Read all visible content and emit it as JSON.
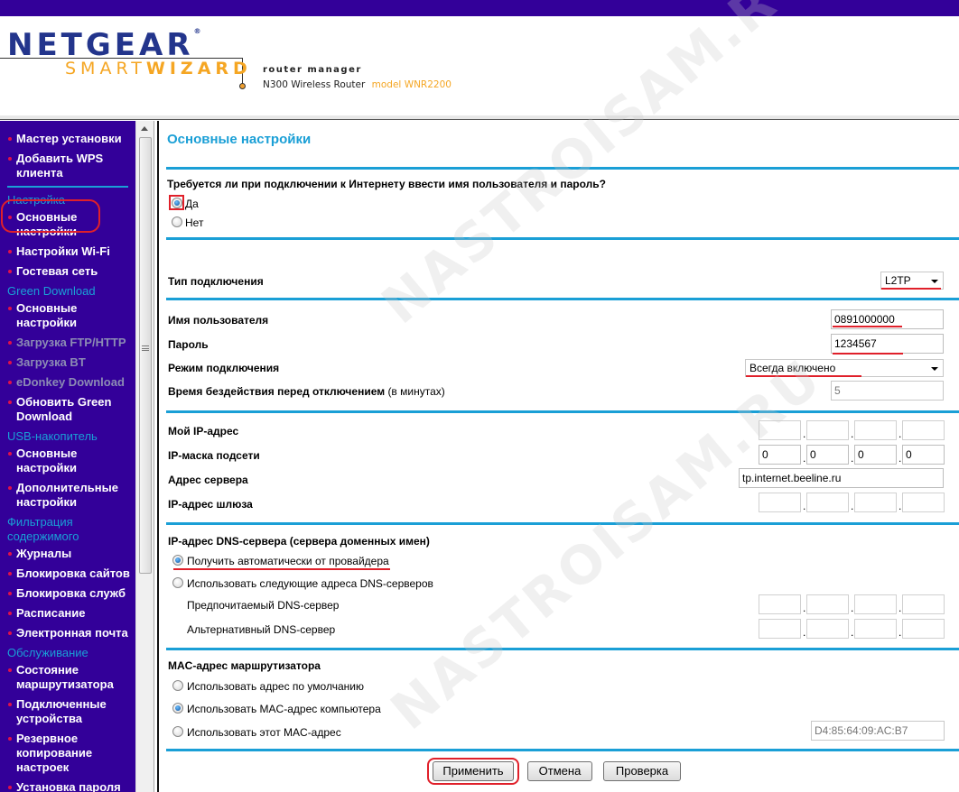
{
  "header": {
    "brand": "NETGEAR",
    "product_smart": "SMART",
    "product_wizard": "WIZARD",
    "subtitle": "router manager",
    "device": "N300 Wireless Router",
    "model": "model WNR2200"
  },
  "sidebar": {
    "items": [
      {
        "type": "item",
        "label": "Мастер установки"
      },
      {
        "type": "item",
        "label": "Добавить WPS клиента"
      },
      {
        "type": "divider"
      },
      {
        "type": "section",
        "label": "Настройка"
      },
      {
        "type": "item",
        "label": "Основные настройки",
        "highlighted": true
      },
      {
        "type": "item",
        "label": "Настройки Wi-Fi"
      },
      {
        "type": "item",
        "label": "Гостевая сеть"
      },
      {
        "type": "section",
        "label": "Green Download"
      },
      {
        "type": "item",
        "label": "Основные настройки"
      },
      {
        "type": "item",
        "label": "Загрузка FTP/HTTP",
        "disabled": true
      },
      {
        "type": "item",
        "label": "Загрузка BT",
        "disabled": true
      },
      {
        "type": "item",
        "label": "eDonkey Download",
        "disabled": true
      },
      {
        "type": "item",
        "label": "Обновить Green Download"
      },
      {
        "type": "section",
        "label": "USB-накопитель"
      },
      {
        "type": "item",
        "label": "Основные настройки"
      },
      {
        "type": "item",
        "label": "Дополнительные настройки"
      },
      {
        "type": "section",
        "label": "Фильтрация содержимого"
      },
      {
        "type": "item",
        "label": "Журналы"
      },
      {
        "type": "item",
        "label": "Блокировка сайтов"
      },
      {
        "type": "item",
        "label": "Блокировка служб"
      },
      {
        "type": "item",
        "label": "Расписание"
      },
      {
        "type": "item",
        "label": "Электронная почта"
      },
      {
        "type": "section",
        "label": "Обслуживание"
      },
      {
        "type": "item",
        "label": "Состояние маршрутизатора"
      },
      {
        "type": "item",
        "label": "Подключенные устройства"
      },
      {
        "type": "item",
        "label": "Резервное копирование настроек"
      },
      {
        "type": "item",
        "label": "Установка пароля"
      }
    ]
  },
  "main": {
    "title": "Основные настройки",
    "login_question": "Требуется ли при подключении к Интернету ввести имя пользователя и пароль?",
    "login_yes": "Да",
    "login_no": "Нет",
    "login_selected": "yes",
    "connection_type_label": "Тип подключения",
    "connection_type_value": "L2TP",
    "username_label": "Имя пользователя",
    "username_value": "0891000000",
    "password_label": "Пароль",
    "password_value": "1234567",
    "connection_mode_label": "Режим подключения",
    "connection_mode_value": "Всегда включено",
    "idle_timeout_label": "Время бездействия перед отключением",
    "idle_timeout_unit": "(в минутах)",
    "idle_timeout_value": "5",
    "my_ip_label": "Мой IP-адрес",
    "my_ip": [
      "",
      "",
      "",
      ""
    ],
    "subnet_label": "IP-маска подсети",
    "subnet": [
      "0",
      "0",
      "0",
      "0"
    ],
    "server_label": "Адрес сервера",
    "server_value": "tp.internet.beeline.ru",
    "gateway_label": "IP-адрес шлюза",
    "gateway": [
      "",
      "",
      "",
      ""
    ],
    "dns_label": "IP-адрес DNS-сервера (сервера доменных имен)",
    "dns_auto": "Получить автоматически от провайдера",
    "dns_manual": "Использовать следующие адреса DNS-серверов",
    "dns_selected": "auto",
    "dns_primary_label": "Предпочитаемый DNS-сервер",
    "dns_primary": [
      "",
      "",
      "",
      ""
    ],
    "dns_secondary_label": "Альтернативный DNS-сервер",
    "dns_secondary": [
      "",
      "",
      "",
      ""
    ],
    "mac_label": "MAC-адрес маршрутизатора",
    "mac_default": "Использовать адрес по умолчанию",
    "mac_computer": "Использовать MAC-адрес компьютера",
    "mac_custom": "Использовать этот MAC-адрес",
    "mac_selected": "computer",
    "mac_value": "D4:85:64:09:AC:B7",
    "apply_label": "Применить",
    "cancel_label": "Отмена",
    "test_label": "Проверка"
  },
  "watermark": "NASTROISAM.RU",
  "colors": {
    "brand_purple": "#330099",
    "accent_blue": "#1a9fd6",
    "annotation_red": "#e0202a",
    "logo_orange": "#f5a623",
    "logo_navy": "#23358c"
  }
}
